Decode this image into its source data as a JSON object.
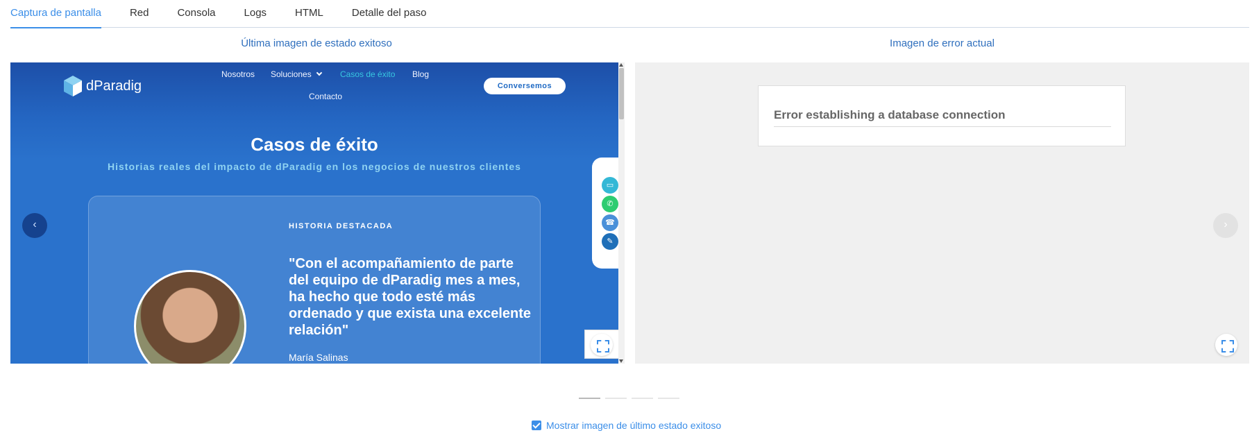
{
  "tabs": [
    {
      "label": "Captura de pantalla"
    },
    {
      "label": "Red"
    },
    {
      "label": "Consola"
    },
    {
      "label": "Logs"
    },
    {
      "label": "HTML"
    },
    {
      "label": "Detalle del paso"
    }
  ],
  "panels": {
    "left_title": "Última imagen de estado exitoso",
    "right_title": "Imagen de error actual"
  },
  "site": {
    "logo_text": "dParadig",
    "nav": {
      "nosotros": "Nosotros",
      "soluciones": "Soluciones",
      "casos": "Casos de éxito",
      "blog": "Blog",
      "contacto": "Contacto"
    },
    "cta": "Conversemos",
    "hero_title": "Casos de éxito",
    "hero_subtitle": "Historias reales del impacto de dParadig en los negocios de nuestros clientes",
    "card_label": "HISTORIA DESTACADA",
    "quote": "\"Con el acompañamiento de parte del equipo de dParadig mes a mes, ha hecho que todo esté más ordenado y que exista una excelente relación\"",
    "author": "María Salinas"
  },
  "error": {
    "message": "Error establishing a database connection"
  },
  "toggle": {
    "label": "Mostrar imagen de último estado exitoso",
    "checked": true
  },
  "colors": {
    "accent": "#3b8ee8",
    "site_blue": "#2466c2"
  }
}
